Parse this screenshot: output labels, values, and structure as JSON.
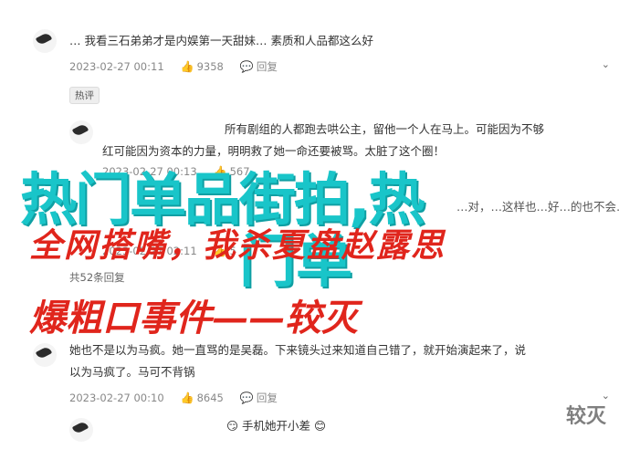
{
  "comments": [
    {
      "text": "… 我看三石弟弟才是内娱第一天甜妹… 素质和人品都这么好",
      "date": "2023-02-27 00:11",
      "likes": "9358",
      "reply_label": "回复"
    },
    {
      "badge": "热评"
    },
    {
      "text_line1": "所有剧组的人都跑去哄公主，留他一个人在马上。可能因为不够",
      "text_line2": "红可能因为资本的力量，明明救了她一命还要被骂。太脏了这个圈！",
      "date": "2023-02-27 00:13",
      "likes": "567"
    },
    {
      "text": "…对，…这样也…好…的也不会…",
      "date": "2023-02-27 02:11",
      "likes": "5"
    },
    {
      "reply_count": "共52条回复"
    },
    {
      "text_line1": "她也不是以为马疯。她一直骂的是吴磊。下来镜头过来知道自己错了，就开始演起来了，说",
      "text_line2": "以为马疯了。马可不背锅",
      "date": "2023-02-27 00:10",
      "likes": "8645",
      "reply_label": "回复"
    },
    {
      "text": "手机她开小差"
    }
  ],
  "overlay": {
    "title_a": "热门单品街拍,热",
    "title_b": "门单",
    "red_line1": "全网搭嘴，我杀夏盘赵露思",
    "red_line2": "爆粗口事件——较灭",
    "watermark": "较灭"
  },
  "icons": {
    "like": "thumbs-up-icon",
    "reply": "comment-icon",
    "more": "chevron-down-icon"
  },
  "colors": {
    "overlay_cyan": "#19c5c9",
    "overlay_red": "#e0251c"
  }
}
